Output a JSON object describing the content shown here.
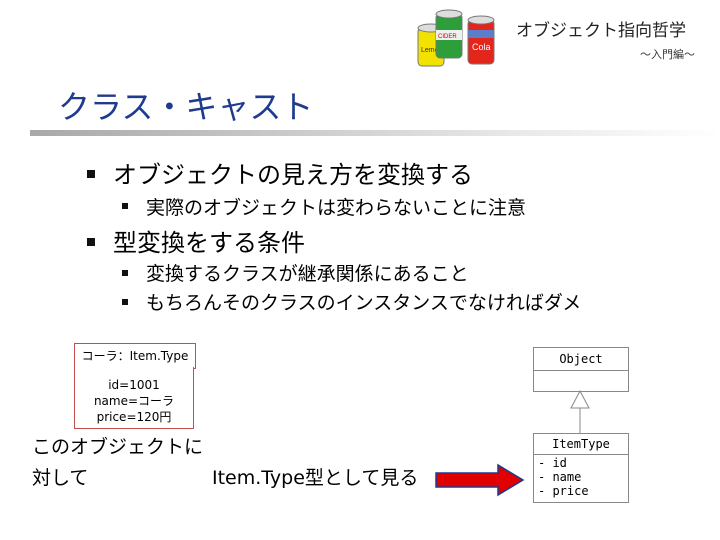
{
  "header": {
    "brand_title": "オブジェクト指向哲学",
    "brand_subtitle": "～入門編～",
    "logo_can_labels": [
      "Cola",
      "Lemon",
      "CIDER"
    ]
  },
  "slide": {
    "title": "クラス・キャスト",
    "bullets": [
      {
        "text": "オブジェクトの見え方を変換する",
        "children": [
          "実際のオブジェクトは変わらないことに注意"
        ]
      },
      {
        "text": "型変換をする条件",
        "children": [
          "変換するクラスが継承関係にあること",
          "もちろんそのクラスのインスタンスでなければダメ"
        ]
      }
    ]
  },
  "object_box": {
    "header": "コーラ：Item.Type",
    "fields": [
      "id=1001",
      "name=コーラ",
      "price=120円"
    ]
  },
  "caption": {
    "line1": "このオブジェクトに",
    "line2": "対して",
    "line2_right": "Item.Type型として見る"
  },
  "uml": {
    "parent": {
      "name": "Object"
    },
    "child": {
      "name": "ItemType",
      "attributes": [
        "- id",
        "- name",
        "- price"
      ]
    }
  },
  "colors": {
    "title": "#1f3a8f",
    "arrow": "#e00000",
    "arrow_outline": "#1f3a8f",
    "object_border": "#c0504d"
  }
}
